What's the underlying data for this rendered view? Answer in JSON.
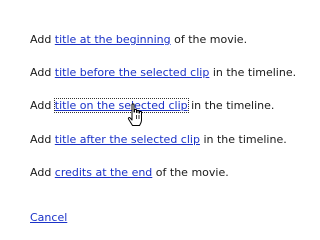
{
  "options": [
    {
      "prefix": "Add ",
      "link": "title at the beginning",
      "suffix": " of the movie."
    },
    {
      "prefix": "Add ",
      "link": "title before the selected clip",
      "suffix": " in the timeline."
    },
    {
      "prefix": "Add ",
      "link": "title on the selected clip",
      "suffix": " in the timeline."
    },
    {
      "prefix": "Add ",
      "link": "title after the selected clip",
      "suffix": " in the timeline."
    },
    {
      "prefix": "Add ",
      "link": "credits at the end",
      "suffix": " of the movie."
    }
  ],
  "cancel_label": "Cancel",
  "colors": {
    "link": "#1b32c8",
    "text": "#1a1a1a",
    "background": "#ffffff"
  },
  "cursor": "hand-pointer-icon"
}
